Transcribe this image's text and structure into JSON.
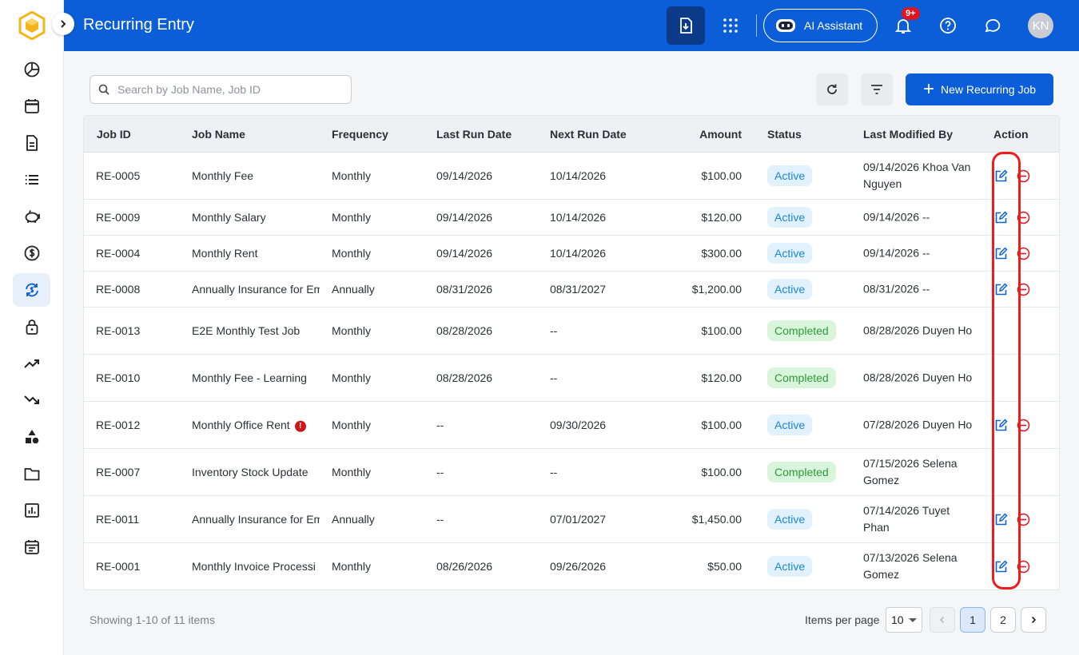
{
  "header": {
    "title": "Recurring Entry",
    "ai_label": "AI Assistant",
    "notif_badge": "9+",
    "avatar_initials": "KN"
  },
  "sidebar": {
    "items": [
      {
        "icon": "chart-pie-icon"
      },
      {
        "icon": "calendar-icon"
      },
      {
        "icon": "document-icon"
      },
      {
        "icon": "list-icon"
      },
      {
        "icon": "piggy-bank-icon"
      },
      {
        "icon": "dollar-circle-icon"
      },
      {
        "icon": "recurring-icon",
        "active": true
      },
      {
        "icon": "lock-icon"
      },
      {
        "icon": "trend-up-icon"
      },
      {
        "icon": "trend-down-icon"
      },
      {
        "icon": "shapes-icon"
      },
      {
        "icon": "folder-icon"
      },
      {
        "icon": "report-icon"
      },
      {
        "icon": "schedule-icon"
      }
    ]
  },
  "toolbar": {
    "search_placeholder": "Search by Job Name, Job ID",
    "new_label": "New Recurring Job"
  },
  "table": {
    "columns": [
      "Job ID",
      "Job Name",
      "Frequency",
      "Last Run Date",
      "Next Run Date",
      "Amount",
      "Status",
      "Last Modified By",
      "Action"
    ],
    "rows": [
      {
        "id": "RE-0005",
        "name": "Monthly Fee",
        "freq": "Monthly",
        "last": "09/14/2026",
        "next": "10/14/2026",
        "amount": "$100.00",
        "status": "Active",
        "modified": "09/14/2026 Khoa Van Nguyen",
        "actions": true,
        "warn": false
      },
      {
        "id": "RE-0009",
        "name": "Monthly Salary",
        "freq": "Monthly",
        "last": "09/14/2026",
        "next": "10/14/2026",
        "amount": "$120.00",
        "status": "Active",
        "modified": "09/14/2026 --",
        "actions": true,
        "warn": false
      },
      {
        "id": "RE-0004",
        "name": "Monthly Rent",
        "freq": "Monthly",
        "last": "09/14/2026",
        "next": "10/14/2026",
        "amount": "$300.00",
        "status": "Active",
        "modified": "09/14/2026 --",
        "actions": true,
        "warn": false
      },
      {
        "id": "RE-0008",
        "name": "Annually Insurance for Em",
        "freq": "Annually",
        "last": "08/31/2026",
        "next": "08/31/2027",
        "amount": "$1,200.00",
        "status": "Active",
        "modified": "08/31/2026 --",
        "actions": true,
        "warn": false
      },
      {
        "id": "RE-0013",
        "name": "E2E Monthly Test Job",
        "freq": "Monthly",
        "last": "08/28/2026",
        "next": "--",
        "amount": "$100.00",
        "status": "Completed",
        "modified": "08/28/2026 Duyen Ho",
        "actions": false,
        "warn": false
      },
      {
        "id": "RE-0010",
        "name": "Monthly Fee - Learning",
        "freq": "Monthly",
        "last": "08/28/2026",
        "next": "--",
        "amount": "$120.00",
        "status": "Completed",
        "modified": "08/28/2026 Duyen Ho",
        "actions": false,
        "warn": false
      },
      {
        "id": "RE-0012",
        "name": "Monthly Office Rent",
        "freq": "Monthly",
        "last": "--",
        "next": "09/30/2026",
        "amount": "$100.00",
        "status": "Active",
        "modified": "07/28/2026 Duyen Ho",
        "actions": true,
        "warn": true
      },
      {
        "id": "RE-0007",
        "name": "Inventory Stock Update",
        "freq": "Monthly",
        "last": "--",
        "next": "--",
        "amount": "$100.00",
        "status": "Completed",
        "modified": "07/15/2026 Selena Gomez",
        "actions": false,
        "warn": false
      },
      {
        "id": "RE-0011",
        "name": "Annually Insurance for Em",
        "freq": "Annually",
        "last": "--",
        "next": "07/01/2027",
        "amount": "$1,450.00",
        "status": "Active",
        "modified": "07/14/2026 Tuyet Phan",
        "actions": true,
        "warn": false
      },
      {
        "id": "RE-0001",
        "name": "Monthly Invoice Processi",
        "freq": "Monthly",
        "last": "08/26/2026",
        "next": "09/26/2026",
        "amount": "$50.00",
        "status": "Active",
        "modified": "07/13/2026 Selena Gomez",
        "actions": true,
        "warn": false
      }
    ]
  },
  "footer": {
    "showing": "Showing 1-10 of 11 items",
    "ipp_label": "Items per page",
    "ipp_value": "10",
    "pages": [
      "1",
      "2"
    ]
  },
  "colors": {
    "brand": "#0b5ed7",
    "active_pill": "#e1f1fd",
    "completed_pill": "#d9f5dc",
    "highlight": "#ee1c1c"
  }
}
